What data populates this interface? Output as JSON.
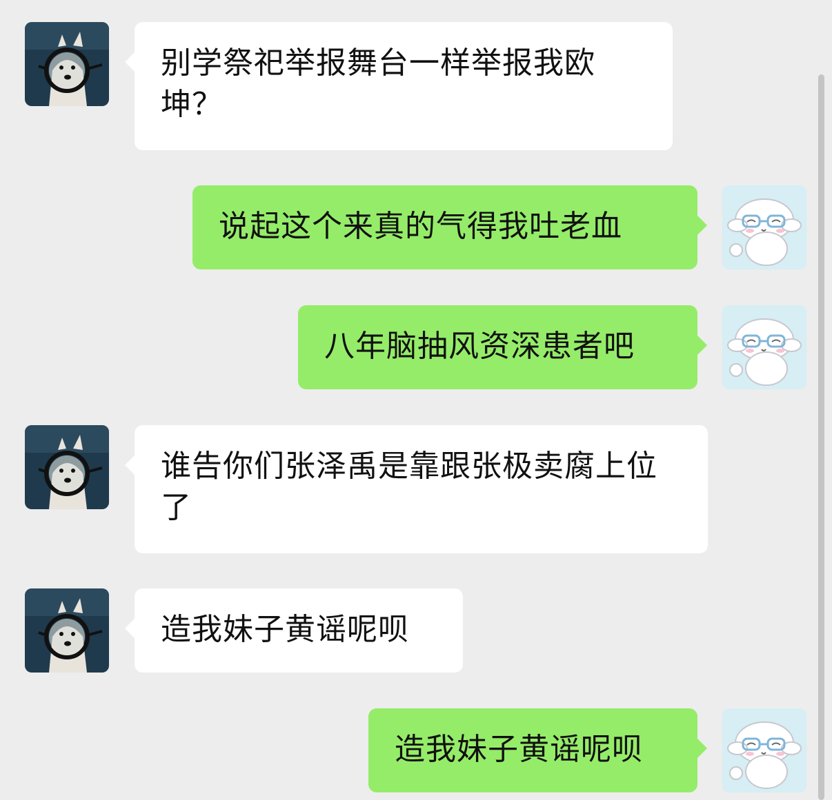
{
  "conversation": {
    "messages": [
      {
        "side": "incoming",
        "avatar": "dog-with-glasses-avatar",
        "text": "别学祭祀举报舞台一样举报我欧坤？"
      },
      {
        "side": "outgoing",
        "avatar": "white-puppy-glasses-avatar",
        "text": "说起这个来真的气得我吐老血"
      },
      {
        "side": "outgoing",
        "avatar": "white-puppy-glasses-avatar",
        "text": "八年脑抽风资深患者吧"
      },
      {
        "side": "incoming",
        "avatar": "dog-with-glasses-avatar",
        "text": "谁告你们张泽禹是靠跟张极卖腐上位了"
      },
      {
        "side": "incoming",
        "avatar": "dog-with-glasses-avatar",
        "text": "造我妹子黄谣呢呗"
      },
      {
        "side": "outgoing",
        "avatar": "white-puppy-glasses-avatar",
        "text": "造我妹子黄谣呢呗"
      }
    ]
  },
  "colors": {
    "background": "#ededed",
    "incoming_bubble": "#ffffff",
    "outgoing_bubble": "#95ec69",
    "text": "#111111"
  }
}
